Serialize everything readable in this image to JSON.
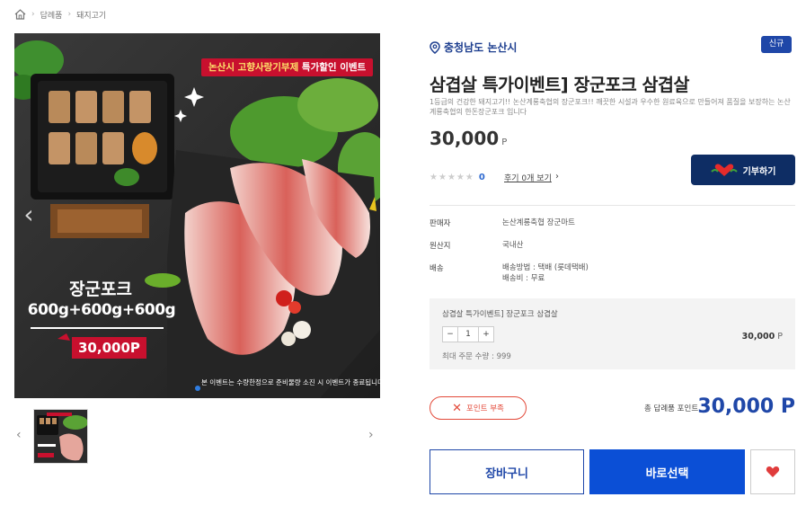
{
  "breadcrumb": {
    "items": [
      "답례품",
      "돼지고기"
    ]
  },
  "image": {
    "banner_highlight": "논산시 고향사랑기부제",
    "banner_rest": "특가할인 이벤트",
    "brand_title": "장군포크",
    "weights": "600g+600g+600g",
    "price_tag": "30,000P",
    "note": "본 이벤트는 수량한정으로 준비물량 소진 시 이벤트가 종료됩니다."
  },
  "product": {
    "region": "충청남도 논산시",
    "badge": "신규",
    "title": "삼겹살 특가이벤트] 장군포크 삼겹살",
    "description": "1등급의 건강한 돼지고기!! 논산계룡축협의 장군포크!! 깨끗한 시설과 우수한 원료육으로 만들어져 품질을 보장하는 논산계룡축협의 한돈장군포크 입니다",
    "price": "30,000",
    "price_unit": "P",
    "rating": "0",
    "review_link": "후기 0개 보기",
    "donate_button": "기부하기"
  },
  "info": {
    "seller_label": "판매자",
    "seller_value": "논산계룡축협 장군마트",
    "origin_label": "원산지",
    "origin_value": "국내산",
    "shipping_label": "배송",
    "shipping_method": "배송방법 : 택배 (롯데택배)",
    "shipping_fee": "배송비 : 무료"
  },
  "option": {
    "name": "삼겹살 특가이벤트] 장군포크 삼겹살",
    "quantity": "1",
    "price": "30,000",
    "price_unit": "P",
    "max_qty": "최대 주문 수량 : 999"
  },
  "points_warning": "포인트 부족",
  "total": {
    "label": "총 답례품 포인트",
    "price": "30,000 P"
  },
  "actions": {
    "cart": "장바구니",
    "buy": "바로선택"
  },
  "colors": {
    "primary": "#0b4fd6",
    "navy": "#0e2d64",
    "accent_red": "#c8102e",
    "warning": "#e34a3a"
  }
}
